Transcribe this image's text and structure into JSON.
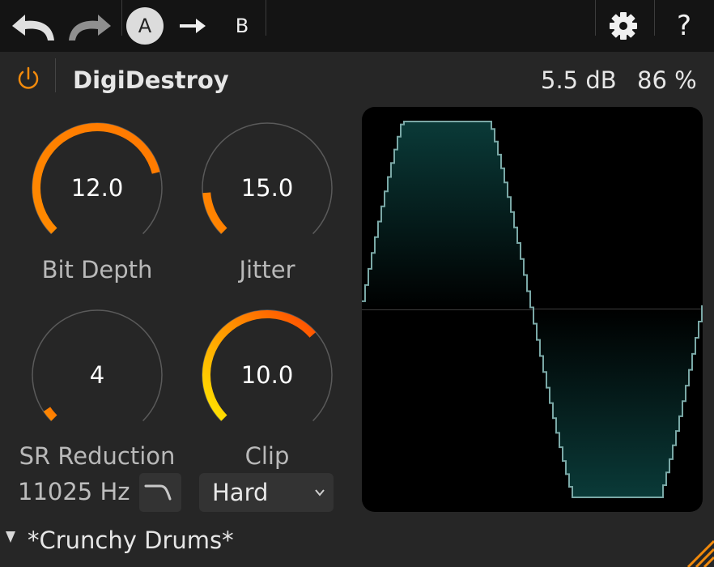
{
  "toolbar": {
    "undo_icon": "undo-arrow-icon",
    "redo_icon": "redo-arrow-icon",
    "a_label": "A",
    "b_label": "B",
    "settings_icon": "gear-icon",
    "help_label": "?"
  },
  "plugin": {
    "title": "DigiDestroy",
    "gain": "5.5 dB",
    "mix": "86 %",
    "accent_color": "#f28a0c"
  },
  "knobs": [
    {
      "label": "Bit Depth",
      "value": "12.0",
      "fraction": 0.78
    },
    {
      "label": "Jitter",
      "value": "15.0",
      "fraction": 0.15
    },
    {
      "label": "SR Reduction",
      "value": "4",
      "fraction": 0.04
    },
    {
      "label": "Clip",
      "value": "10.0",
      "fraction": 0.68
    }
  ],
  "sample_rate": {
    "readout": "11025 Hz",
    "filter_icon": "filter-curve-icon"
  },
  "clip_mode": {
    "selected": "Hard"
  },
  "scope": {
    "fill_color": "#0a3a38",
    "line_color": "#7aa8a6"
  },
  "preset": {
    "name": "*Crunchy Drums*"
  }
}
